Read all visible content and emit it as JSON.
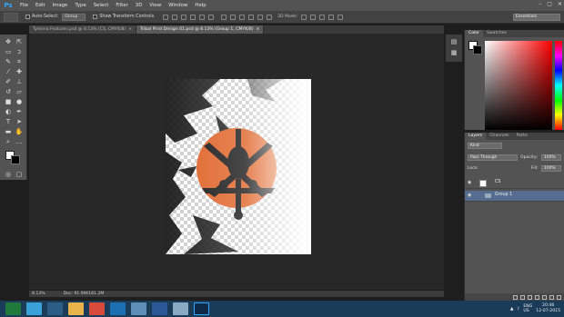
{
  "app": {
    "logo": "Ps",
    "window_controls": [
      "–",
      "▢",
      "✕"
    ]
  },
  "menu": [
    "File",
    "Edit",
    "Image",
    "Type",
    "Select",
    "Filter",
    "3D",
    "View",
    "Window",
    "Help"
  ],
  "options": {
    "auto_select_label": "Auto-Select:",
    "auto_select_value": "Group",
    "show_transform_label": "Show Transform Controls",
    "mode_3d_label": "3D Mode:",
    "workspace": "Essentials"
  },
  "tabs": [
    {
      "label": "Tylenna Features.psd @ 8.13% (CS, CMYK/8)",
      "active": false
    },
    {
      "label": "Tribal Print Design 01.psd @ 8.13% (Group 1, CMYK/8)",
      "active": true
    }
  ],
  "tab_close": "×",
  "status": {
    "zoom": "8.13%",
    "doc": "Doc: 91.9M/181.2M"
  },
  "color_panel": {
    "tabs": [
      "Color",
      "Swatches"
    ]
  },
  "layers_panel": {
    "tabs": [
      "Layers",
      "Channels",
      "Paths"
    ],
    "kind": "Kind",
    "blend_mode": "Pass Through",
    "opacity_label": "Opacity:",
    "opacity": "100%",
    "lock_label": "Lock:",
    "fill_label": "Fill:",
    "fill": "100%",
    "layers": [
      {
        "name": "CS",
        "selected": false
      },
      {
        "name": "Group 1",
        "selected": true
      }
    ]
  },
  "taskbar": {
    "lang": "ENG",
    "region": "US",
    "time": "20:46",
    "date": "12-07-2015"
  },
  "colors": {
    "accent": "#566d8f",
    "ps_blue": "#31a8ff",
    "artwork_orange": "#e0652a"
  }
}
